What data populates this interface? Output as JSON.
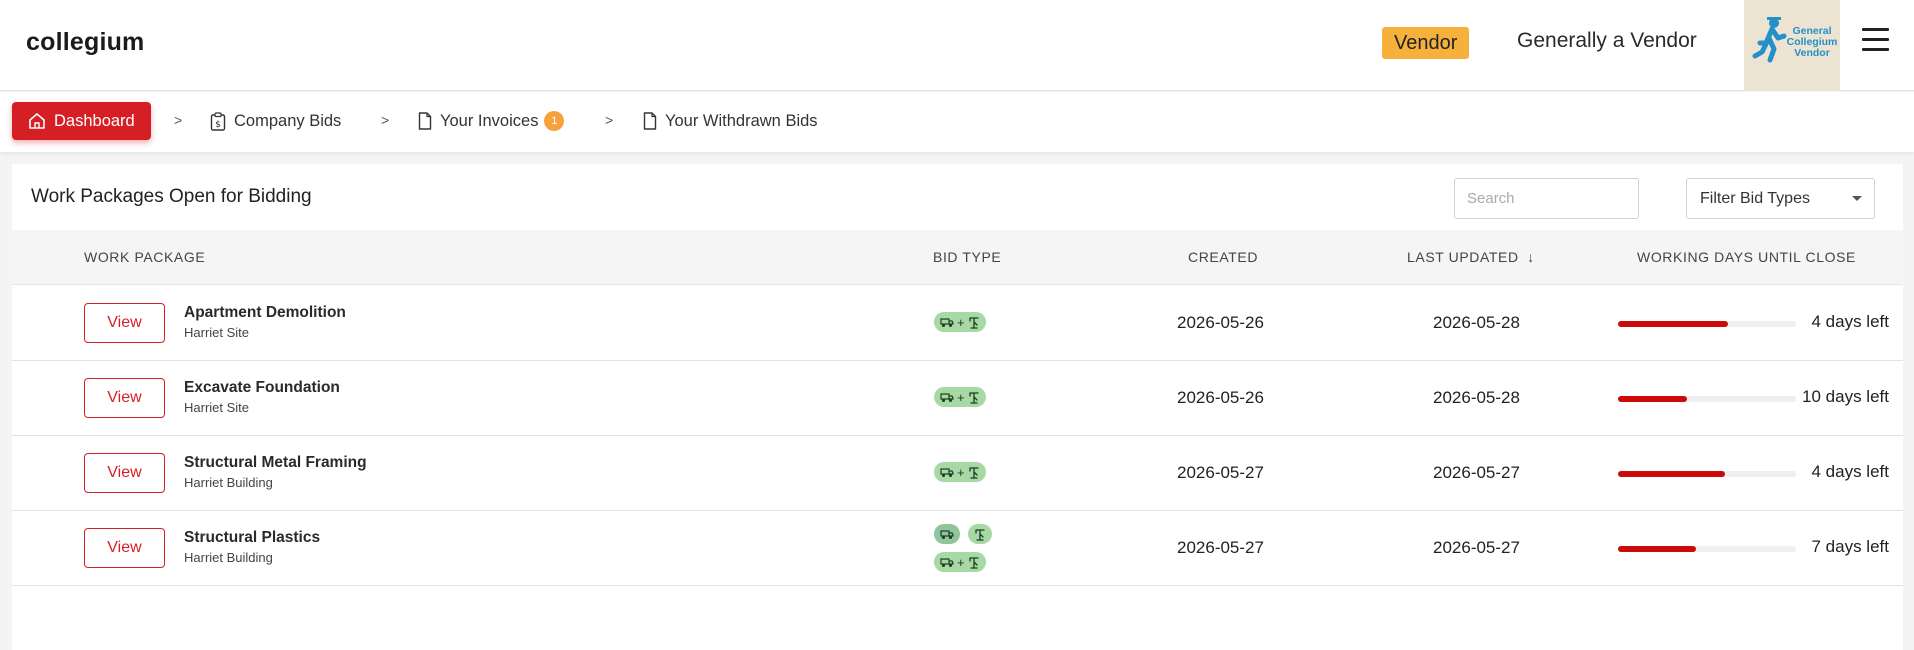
{
  "header": {
    "brand": "collegium",
    "role_badge": "Vendor",
    "company_name": "Generally a Vendor",
    "logo_text": [
      "General",
      "Collegium",
      "Vendor"
    ]
  },
  "nav": {
    "items": [
      {
        "label": "Dashboard",
        "icon": "home-icon",
        "active": true
      },
      {
        "label": "Company Bids",
        "icon": "clipboard-dollar-icon"
      },
      {
        "label": "Your Invoices",
        "icon": "document-icon",
        "badge": "1"
      },
      {
        "label": "Your Withdrawn Bids",
        "icon": "document-icon"
      }
    ],
    "separator": ">"
  },
  "panel": {
    "title": "Work Packages Open for Bidding",
    "search_placeholder": "Search",
    "filter_label": "Filter Bid Types",
    "columns": {
      "work_package": "WORK PACKAGE",
      "bid_type": "BID TYPE",
      "created": "CREATED",
      "last_updated": "LAST UPDATED",
      "working_days": "WORKING DAYS UNTIL CLOSE"
    },
    "sort_indicator": "↓",
    "view_label": "View",
    "rows": [
      {
        "name": "Apartment Demolition",
        "site": "Harriet Site",
        "bid_types": [
          "combined"
        ],
        "created": "2026-05-26",
        "last_updated": "2026-05-28",
        "days_left": "4 days left",
        "progress": 0.62
      },
      {
        "name": "Excavate Foundation",
        "site": "Harriet Site",
        "bid_types": [
          "combined"
        ],
        "created": "2026-05-26",
        "last_updated": "2026-05-28",
        "days_left": "10 days left",
        "progress": 0.39
      },
      {
        "name": "Structural Metal Framing",
        "site": "Harriet Building",
        "bid_types": [
          "combined"
        ],
        "created": "2026-05-27",
        "last_updated": "2026-05-27",
        "days_left": "4 days left",
        "progress": 0.6
      },
      {
        "name": "Structural Plastics",
        "site": "Harriet Building",
        "bid_types": [
          "split",
          "combined"
        ],
        "created": "2026-05-27",
        "last_updated": "2026-05-27",
        "days_left": "7 days left",
        "progress": 0.44
      }
    ]
  },
  "colors": {
    "accent": "#d61f24",
    "badge": "#f6b13c",
    "bid_pill": "#a6d9a4",
    "progress": "#cc0a0a"
  }
}
